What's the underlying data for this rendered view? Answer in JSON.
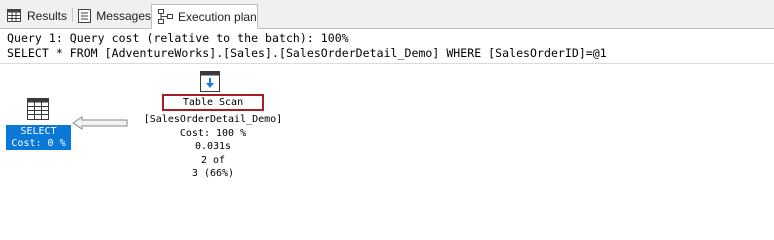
{
  "tabs": [
    {
      "label": "Results",
      "icon": "grid-icon",
      "active": false
    },
    {
      "label": "Messages",
      "icon": "messages-icon",
      "active": false
    },
    {
      "label": "Execution plan",
      "icon": "execution-plan-icon",
      "active": true
    }
  ],
  "query": {
    "cost_line": "Query 1: Query cost (relative to the batch): 100%",
    "sql_line": "SELECT * FROM [AdventureWorks].[Sales].[SalesOrderDetail_Demo] WHERE [SalesOrderID]=@1"
  },
  "plan": {
    "select_node": {
      "icon": "select-result-icon",
      "name": "SELECT",
      "cost": "Cost: 0 %"
    },
    "table_scan_node": {
      "icon": "table-scan-icon",
      "name": "Table Scan",
      "object": "[SalesOrderDetail_Demo]",
      "cost": "Cost: 100 %",
      "time": "0.031s",
      "rows_actual": "2 of",
      "rows_estimated": "3 (66%)"
    }
  },
  "colors": {
    "selected_node_bg": "#0a78d7",
    "highlight_border": "#a71d23",
    "tab_strip_bg": "#f0f0f0"
  }
}
